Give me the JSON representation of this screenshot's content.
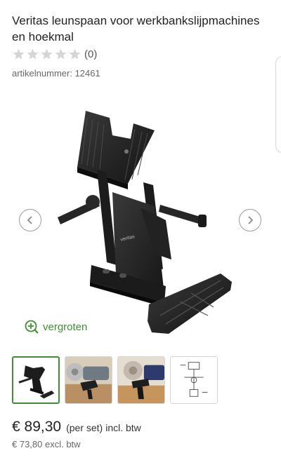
{
  "product": {
    "title": "Veritas leunspaan voor werkbankslijpmachines en hoekmal",
    "rating": {
      "stars_filled": 0,
      "stars_total": 5,
      "count_text": "(0)"
    },
    "sku_label": "artikelnummer: 12461"
  },
  "gallery": {
    "zoom_label": "vergroten",
    "thumbnails": [
      "thumbnail-product",
      "thumbnail-grinder-left",
      "thumbnail-grinder-right",
      "thumbnail-line-drawing"
    ],
    "active_index": 0,
    "logo_text": "veritas"
  },
  "price": {
    "amount": "€ 89,30",
    "unit": "(per set)",
    "incl": "incl. btw",
    "excl": "€ 73,80 excl. btw"
  },
  "colors": {
    "accent": "#3e8f32",
    "star_empty": "#d6d6d6"
  }
}
